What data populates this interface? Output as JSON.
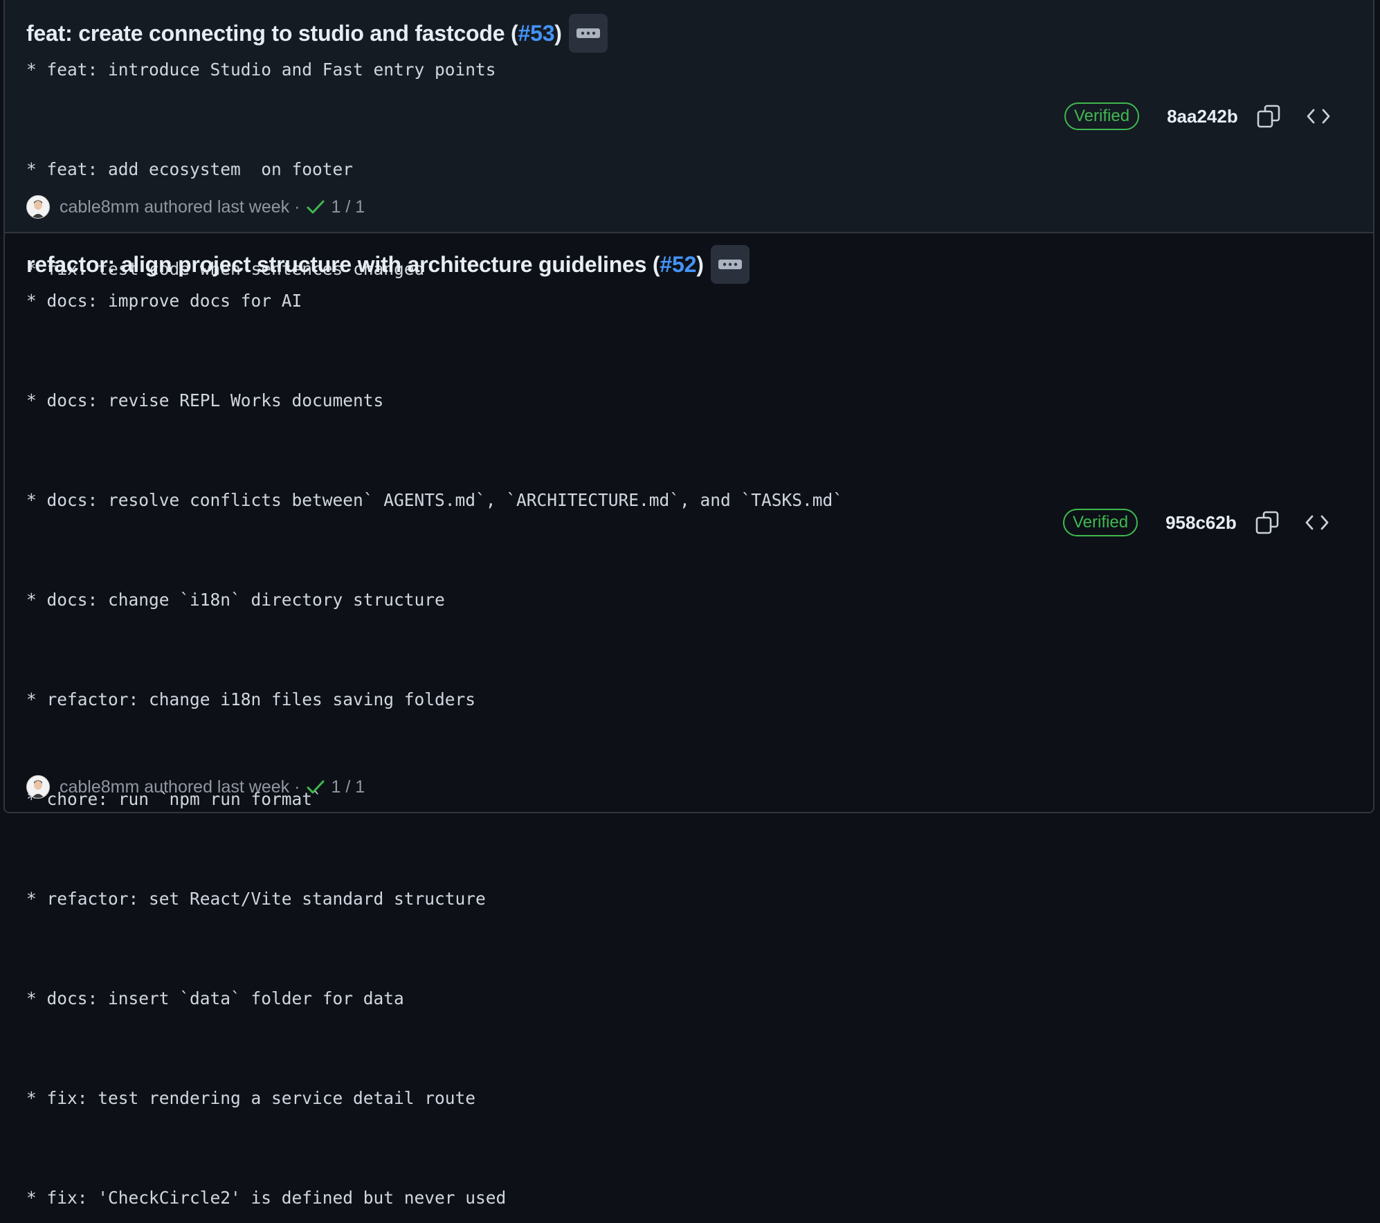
{
  "commits": [
    {
      "title": "feat: create connecting to studio and fastcode (",
      "pr": "#53",
      "title_end": ")",
      "message": "* feat: introduce Studio and Fast entry points\n\n* feat: add ecosystem  on footer\n\n* fix: test code when sentences changed",
      "author": "cable8mm",
      "authored": "authored last week",
      "separator": "·",
      "checks": "1 / 1",
      "badge": "Verified",
      "sha": "8aa242b"
    },
    {
      "title": "refactor: align project structure with architecture guidelines (",
      "pr": "#52",
      "title_end": ")",
      "message": "* docs: improve docs for AI\n\n* docs: revise REPL Works documents\n\n* docs: resolve conflicts between` AGENTS.md`, `ARCHITECTURE.md`, and `TASKS.md`\n\n* docs: change `i18n` directory structure\n\n* refactor: change i18n files saving folders\n\n* chore: run `npm run format`\n\n* refactor: set React/Vite standard structure\n\n* docs: insert `data` folder for data\n\n* fix: test rendering a service detail route\n\n* fix: 'CheckCircle2' is defined but never used",
      "author": "cable8mm",
      "authored": "authored last week",
      "separator": "·",
      "checks": "1 / 1",
      "badge": "Verified",
      "sha": "958c62b"
    }
  ],
  "colors": {
    "background": "#0d1117",
    "row_alt": "#151b23",
    "link": "#4493f8",
    "verified": "#3fb950",
    "muted": "#9198a1"
  },
  "icons": [
    "kebab-horizontal-icon",
    "check-icon",
    "copy-icon",
    "code-icon",
    "avatar"
  ]
}
